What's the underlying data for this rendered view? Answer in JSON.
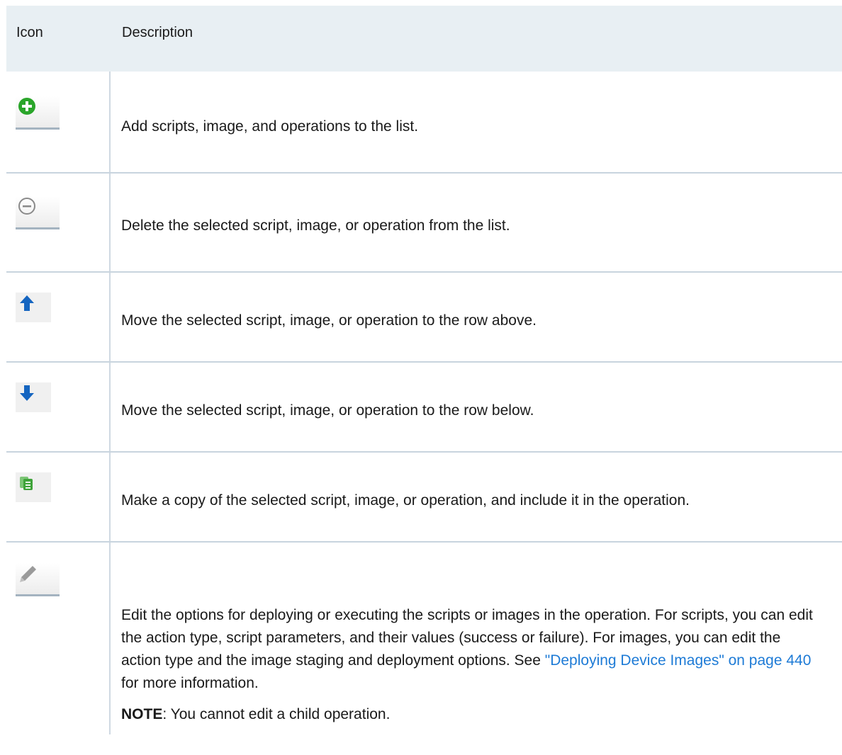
{
  "header": {
    "col_icon": "Icon",
    "col_description": "Description"
  },
  "rows": [
    {
      "icon": "add-icon",
      "description": "Add scripts, image, and operations to the list."
    },
    {
      "icon": "remove-icon",
      "description": "Delete the selected script, image, or operation from the list."
    },
    {
      "icon": "arrow-up-icon",
      "description": "Move the selected script, image, or operation to the row above."
    },
    {
      "icon": "arrow-down-icon",
      "description": "Move the selected script, image, or operation to the row below."
    },
    {
      "icon": "copy-icon",
      "description": "Make a copy of the selected script, image, or operation, and include it in the operation."
    },
    {
      "icon": "edit-icon",
      "description_before_link": "Edit the options for deploying or executing the scripts or images in the operation. For scripts, you can edit the action type, script parameters, and their values (success or failure). For images, you can edit the action type and the image staging and deployment options. See ",
      "link_text": "\"Deploying Device Images\" on page 440",
      "description_after_link": " for more information.",
      "note_label": "NOTE",
      "note_text": ": You cannot edit a child operation."
    }
  ],
  "colors": {
    "link": "#1e7bd6",
    "header_bg": "#e8eff3",
    "add_green": "#2aa52a",
    "arrow_blue": "#1565c0",
    "copy_green": "#5cb85c"
  }
}
